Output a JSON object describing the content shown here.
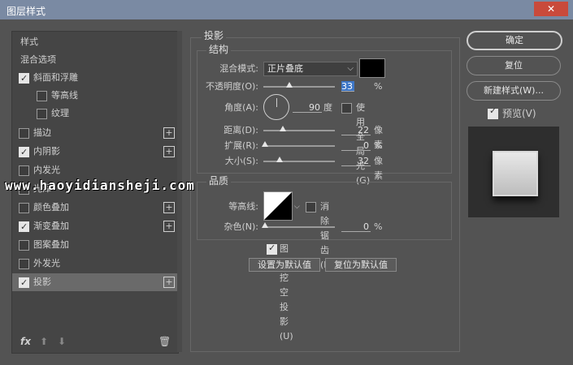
{
  "window": {
    "title": "图层样式",
    "close_glyph": "✕"
  },
  "left_panel": {
    "header_style": "样式",
    "header_blend": "混合选项",
    "items": [
      {
        "label": "斜面和浮雕",
        "checked": true,
        "plus": false
      },
      {
        "label": "等高线",
        "checked": false,
        "plus": false
      },
      {
        "label": "纹理",
        "checked": false,
        "plus": false
      },
      {
        "label": "描边",
        "checked": false,
        "plus": true
      },
      {
        "label": "内阴影",
        "checked": true,
        "plus": true
      },
      {
        "label": "内发光",
        "checked": false,
        "plus": false
      },
      {
        "label": "光泽",
        "checked": false,
        "plus": false
      },
      {
        "label": "颜色叠加",
        "checked": false,
        "plus": true
      },
      {
        "label": "渐变叠加",
        "checked": true,
        "plus": true
      },
      {
        "label": "图案叠加",
        "checked": false,
        "plus": false
      },
      {
        "label": "外发光",
        "checked": false,
        "plus": false
      },
      {
        "label": "投影",
        "checked": true,
        "plus": true,
        "selected": true
      }
    ],
    "footer": {
      "fx": "fx",
      "up": "⬆",
      "down": "⬇",
      "trash": "🗑"
    }
  },
  "drop_shadow": {
    "title": "投影",
    "structure": {
      "title": "结构",
      "blend_mode_label": "混合模式:",
      "blend_mode_value": "正片叠底",
      "opacity_label": "不透明度(O):",
      "opacity_value": "33",
      "opacity_unit": "%",
      "angle_label": "角度(A):",
      "angle_value": "90",
      "angle_unit": "度",
      "global_light_label": "使用全局光 (G)",
      "distance_label": "距离(D):",
      "distance_value": "22",
      "distance_unit": "像素",
      "spread_label": "扩展(R):",
      "spread_value": "0",
      "spread_unit": "%",
      "size_label": "大小(S):",
      "size_value": "32",
      "size_unit": "像素"
    },
    "quality": {
      "title": "品质",
      "contour_label": "等高线:",
      "anti_alias_label": "消除锯齿 (L)",
      "noise_label": "杂色(N):",
      "noise_value": "0",
      "noise_unit": "%"
    },
    "knockout_label": "图层挖空投影(U)",
    "make_default": "设置为默认值",
    "reset_default": "复位为默认值"
  },
  "right_panel": {
    "ok": "确定",
    "reset": "复位",
    "new_style": "新建样式(W)...",
    "preview_label": "预览(V)"
  },
  "watermark": "www.haoyidiansheji.com"
}
